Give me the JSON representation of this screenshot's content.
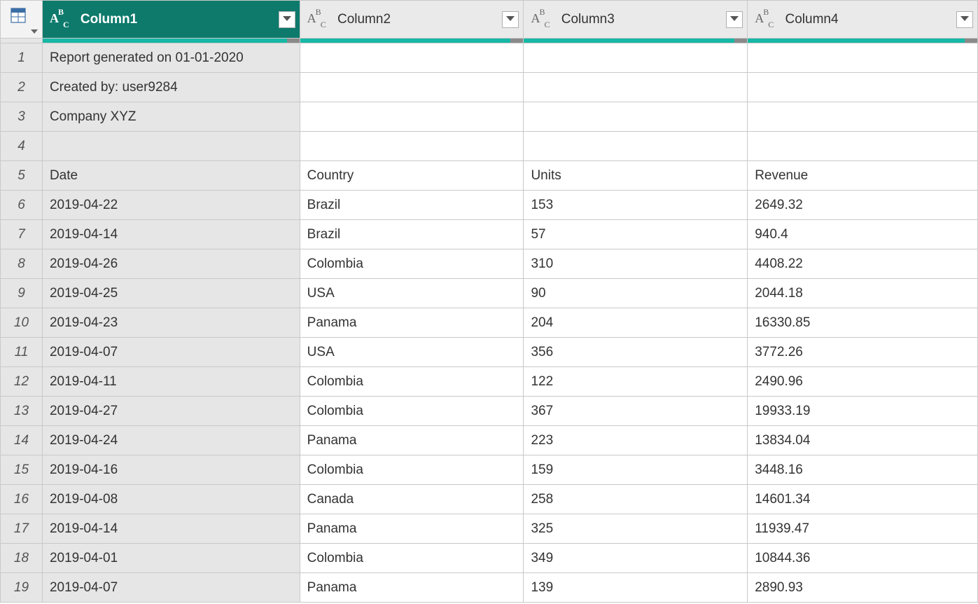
{
  "columns": [
    {
      "name": "Column1",
      "type": "ABC",
      "selected": true
    },
    {
      "name": "Column2",
      "type": "ABC",
      "selected": false
    },
    {
      "name": "Column3",
      "type": "ABC",
      "selected": false
    },
    {
      "name": "Column4",
      "type": "ABC",
      "selected": false
    }
  ],
  "rows": [
    {
      "n": "1",
      "c": [
        "Report generated on 01-01-2020",
        "",
        "",
        ""
      ]
    },
    {
      "n": "2",
      "c": [
        "Created by: user9284",
        "",
        "",
        ""
      ]
    },
    {
      "n": "3",
      "c": [
        "Company XYZ",
        "",
        "",
        ""
      ]
    },
    {
      "n": "4",
      "c": [
        "",
        "",
        "",
        ""
      ]
    },
    {
      "n": "5",
      "c": [
        "Date",
        "Country",
        "Units",
        "Revenue"
      ]
    },
    {
      "n": "6",
      "c": [
        "2019-04-22",
        "Brazil",
        "153",
        "2649.32"
      ]
    },
    {
      "n": "7",
      "c": [
        "2019-04-14",
        "Brazil",
        "57",
        "940.4"
      ]
    },
    {
      "n": "8",
      "c": [
        "2019-04-26",
        "Colombia",
        "310",
        "4408.22"
      ]
    },
    {
      "n": "9",
      "c": [
        "2019-04-25",
        "USA",
        "90",
        "2044.18"
      ]
    },
    {
      "n": "10",
      "c": [
        "2019-04-23",
        "Panama",
        "204",
        "16330.85"
      ]
    },
    {
      "n": "11",
      "c": [
        "2019-04-07",
        "USA",
        "356",
        "3772.26"
      ]
    },
    {
      "n": "12",
      "c": [
        "2019-04-11",
        "Colombia",
        "122",
        "2490.96"
      ]
    },
    {
      "n": "13",
      "c": [
        "2019-04-27",
        "Colombia",
        "367",
        "19933.19"
      ]
    },
    {
      "n": "14",
      "c": [
        "2019-04-24",
        "Panama",
        "223",
        "13834.04"
      ]
    },
    {
      "n": "15",
      "c": [
        "2019-04-16",
        "Colombia",
        "159",
        "3448.16"
      ]
    },
    {
      "n": "16",
      "c": [
        "2019-04-08",
        "Canada",
        "258",
        "14601.34"
      ]
    },
    {
      "n": "17",
      "c": [
        "2019-04-14",
        "Panama",
        "325",
        "11939.47"
      ]
    },
    {
      "n": "18",
      "c": [
        "2019-04-01",
        "Colombia",
        "349",
        "10844.36"
      ]
    },
    {
      "n": "19",
      "c": [
        "2019-04-07",
        "Panama",
        "139",
        "2890.93"
      ]
    }
  ]
}
